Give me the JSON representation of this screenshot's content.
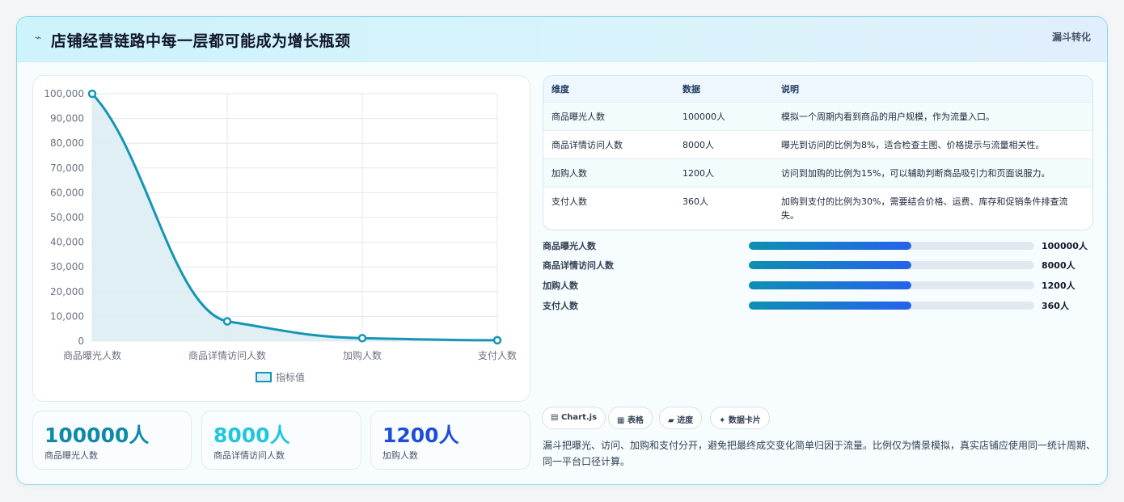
{
  "header": {
    "icon": "pulse-icon",
    "title": "店铺经营链路中每一层都可能成为增长瓶颈",
    "tag": "漏斗转化"
  },
  "chart_data": {
    "type": "line",
    "categories": [
      "商品曝光人数",
      "商品详情访问人数",
      "加购人数",
      "支付人数"
    ],
    "series": [
      {
        "name": "指标值",
        "values": [
          100000,
          8000,
          1200,
          360
        ]
      }
    ],
    "yticks": [
      "0",
      "10,000",
      "20,000",
      "30,000",
      "40,000",
      "50,000",
      "60,000",
      "70,000",
      "80,000",
      "90,000",
      "100,000"
    ],
    "ylim": [
      0,
      100000
    ],
    "fill": "area",
    "smooth": true,
    "grid": true,
    "legend": "bottom",
    "colors": {
      "line": "#1596b4",
      "area": "#dcedf3"
    }
  },
  "kpis": [
    {
      "value": "100000人",
      "label": "商品曝光人数",
      "color": "#0e8aa8"
    },
    {
      "value": "8000人",
      "label": "商品详情访问人数",
      "color": "#22c6dc"
    },
    {
      "value": "1200人",
      "label": "加购人数",
      "color": "#1d4ed8"
    }
  ],
  "table": {
    "headers": [
      "维度",
      "数据",
      "说明"
    ],
    "rows": [
      [
        "商品曝光人数",
        "100000人",
        "模拟一个周期内看到商品的用户规模，作为流量入口。"
      ],
      [
        "商品详情访问人数",
        "8000人",
        "曝光到访问的比例为8%，适合检查主图、价格提示与流量相关性。"
      ],
      [
        "加购人数",
        "1200人",
        "访问到加购的比例为15%，可以辅助判断商品吸引力和页面说服力。"
      ],
      [
        "支付人数",
        "360人",
        "加购到支付的比例为30%，需要结合价格、运费、库存和促销条件排查流失。"
      ]
    ]
  },
  "progress": [
    {
      "label": "商品曝光人数",
      "value": "100000人",
      "fill": 0.57
    },
    {
      "label": "商品详情访问人数",
      "value": "8000人",
      "fill": 0.57
    },
    {
      "label": "加购人数",
      "value": "1200人",
      "fill": 0.57
    },
    {
      "label": "支付人数",
      "value": "360人",
      "fill": 0.57
    }
  ],
  "chips": [
    {
      "icon": "chart-icon",
      "glyph": "▤",
      "label": "Chart.js"
    },
    {
      "icon": "table-icon",
      "glyph": "▦",
      "label": "表格"
    },
    {
      "icon": "folder-icon",
      "glyph": "▰",
      "label": "进度"
    },
    {
      "icon": "sparkle-icon",
      "glyph": "✦",
      "label": "数据卡片"
    }
  ],
  "footnote": "漏斗把曝光、访问、加购和支付分开，避免把最终成交变化简单归因于流量。比例仅为情景模拟，真实店铺应使用同一统计周期、同一平台口径计算。"
}
